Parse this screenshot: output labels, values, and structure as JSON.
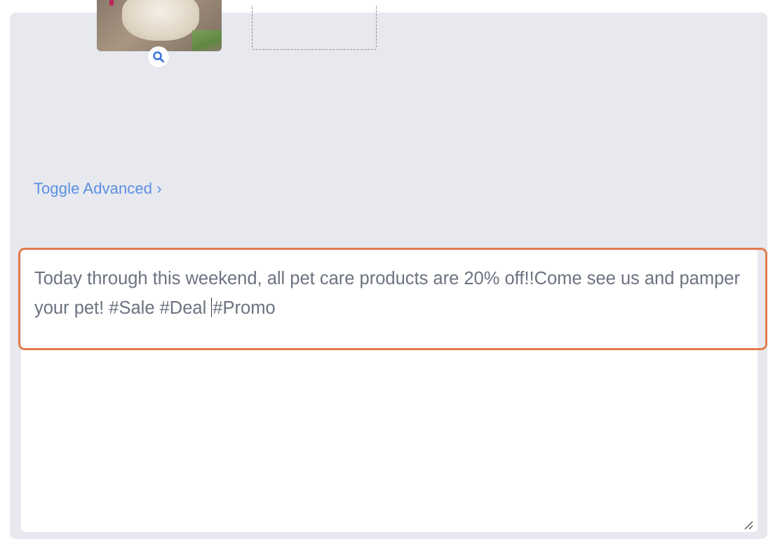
{
  "toggle_advanced": {
    "label": "Toggle Advanced",
    "chevron": "›"
  },
  "post": {
    "text_part1": "Today through this weekend, all pet care products are 20% off!!Come see us and pamper your pet! #Sale #Deal ",
    "text_part2": "#Promo"
  },
  "icons": {
    "zoom": "search-icon",
    "resize": "resize-handle-icon"
  },
  "colors": {
    "accent": "#5b8ee0",
    "highlight": "#e27b4f",
    "panel_bg": "#e7e9ef",
    "text": "#6b7280"
  }
}
